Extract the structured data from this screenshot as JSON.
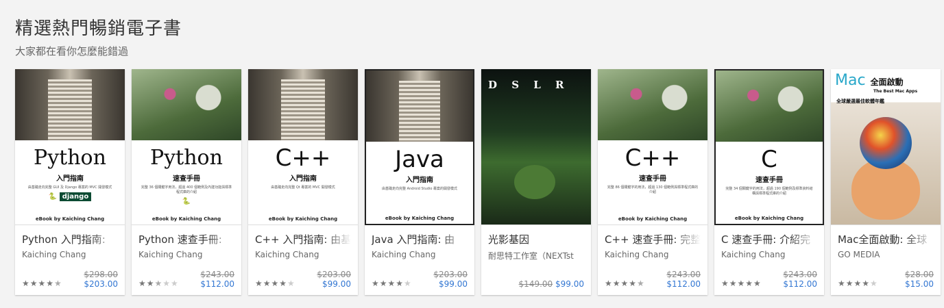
{
  "section": {
    "title": "精選熱門暢銷電子書",
    "subtitle": "大家都在看你怎麼能錯過"
  },
  "books": [
    {
      "title": "Python 入門指南:",
      "author": "Kaiching Chang",
      "old_price": "$298.00",
      "price": "$203.00",
      "rating": 4.5,
      "cover": {
        "big": "Python",
        "sub": "入門指南",
        "tiny": "由基礎走向完整 GUI 及 Django 專案的 MVC 開發模式",
        "logo": "django",
        "byline": "eBook by Kaiching Chang"
      }
    },
    {
      "title": "Python 速查手冊:",
      "author": "Kaiching Chang",
      "old_price": "$243.00",
      "price": "$112.00",
      "rating": 2.5,
      "cover": {
        "big": "Python",
        "sub": "速查手冊",
        "tiny": "完整 36 個關鍵字用法，超過 400 個範例及內建功能與標準程式庫的介紹",
        "byline": "eBook by Kaiching Chang"
      }
    },
    {
      "title": "C++ 入門指南: 由基",
      "author": "Kaiching Chang",
      "old_price": "$203.00",
      "price": "$99.00",
      "rating": 4,
      "cover": {
        "big": "C++",
        "sub": "入門指南",
        "tiny": "由基礎走向完整 Qt 專案的 MVC 開發模式",
        "byline": "eBook by Kaiching Chang"
      }
    },
    {
      "title": "Java 入門指南: 由",
      "author": "Kaiching Chang",
      "old_price": "$203.00",
      "price": "$99.00",
      "rating": 4,
      "cover": {
        "big": "Java",
        "sub": "入門指南",
        "tiny": "由基礎走向完整 Android Studio 專案的開發模式",
        "byline": "eBook by Kaiching Chang"
      }
    },
    {
      "title": "光影基因",
      "author": "耐思特工作室（NEXTst",
      "old_price": "$149.00",
      "price": "$99.00",
      "rating": null,
      "cover": {
        "big": "D S L R"
      }
    },
    {
      "title": "C++ 速查手冊: 完整",
      "author": "Kaiching Chang",
      "old_price": "$243.00",
      "price": "$112.00",
      "rating": 4.5,
      "cover": {
        "big": "C++",
        "sub": "速查手冊",
        "tiny": "完整 86 個關鍵字的用法，超過 130 個範例與標準程式庫的介紹",
        "byline": "eBook by Kaiching Chang"
      }
    },
    {
      "title": "C 速查手冊: 介紹完",
      "author": "Kaiching Chang",
      "old_price": "$243.00",
      "price": "$112.00",
      "rating": 5,
      "cover": {
        "big": "C",
        "sub": "速查手冊",
        "tiny": "完整 34 個關鍵字的用法，超過 190 個範例及標準資料結構與標準程式庫的介紹",
        "byline": "eBook by Kaiching Chang"
      }
    },
    {
      "title": "Mac全面啟動: 全球",
      "author": "GO MEDIA",
      "old_price": "$28.00",
      "price": "$15.00",
      "rating": 4,
      "cover": {
        "big": "Mac",
        "sub": "全面啟動",
        "extra": "The Best Mac Apps",
        "tiny": "全球嚴選最佳軟體年鑑"
      }
    }
  ]
}
